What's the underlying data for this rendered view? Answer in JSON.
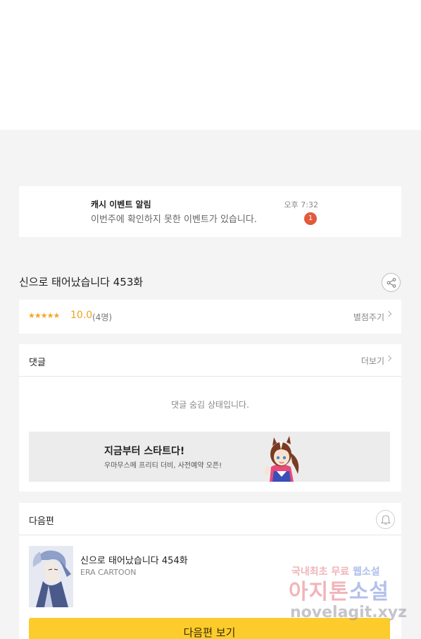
{
  "notification": {
    "title": "캐시 이벤트 알림",
    "body": "이번주에 확인하지 못한 이벤트가 있습니다.",
    "time": "오후 7:32",
    "badge": "1"
  },
  "episode": {
    "title": "신으로 태어났습니다 453화"
  },
  "rating": {
    "stars": "★★★★★",
    "score": "10.0",
    "count": "(4명)",
    "rate_label": "별점주기"
  },
  "comments": {
    "title": "댓글",
    "more_label": "더보기",
    "hidden_message": "댓글 숨김 상태입니다."
  },
  "banner": {
    "title": "지금부터 스타트다!",
    "subtitle": "우마무스메 프리티 더비, 사전예약 오픈!"
  },
  "next_episode": {
    "section_title": "다음편",
    "title": "신으로 태어났습니다 454화",
    "publisher": "ERA CARTOON",
    "button_label": "다음편 보기"
  },
  "watermark": {
    "line1_a": "국내최초 무료 ",
    "line1_b": "웹소설",
    "line2_a": "아지톤",
    "line2_b": "소설",
    "line3": "novelagit.xyz"
  },
  "colors": {
    "accent": "#fccb2c",
    "badge": "#e2593b",
    "stars": "#f5a623"
  }
}
